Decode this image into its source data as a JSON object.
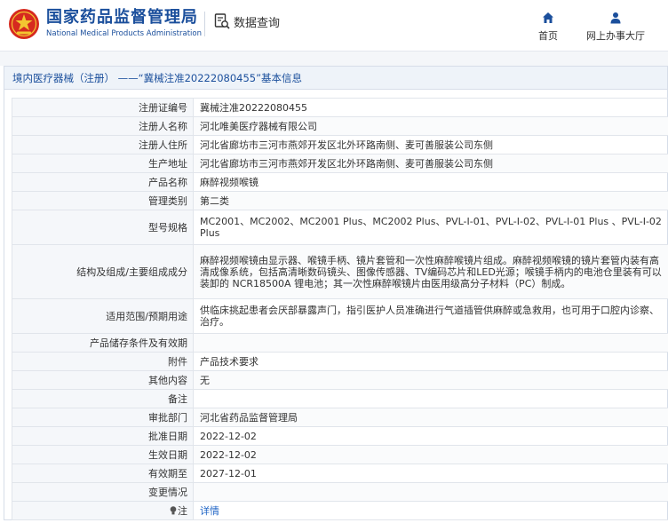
{
  "header": {
    "brand_cn": "国家药品监督管理局",
    "brand_en": "National Medical Products Administration",
    "query_label": "数据查询",
    "nav": [
      {
        "label": "首页",
        "icon": "home-icon"
      },
      {
        "label": "网上办事大厅",
        "icon": "user-icon"
      }
    ],
    "brand_color": "#1b4f9c",
    "logo_color": "#d62a1f"
  },
  "breadcrumb": "境内医疗器械（注册） ——“冀械注准20222080455”基本信息",
  "rows": [
    {
      "key": "注册证编号",
      "value": "冀械注准20222080455"
    },
    {
      "key": "注册人名称",
      "value": "河北唯美医疗器械有限公司"
    },
    {
      "key": "注册人住所",
      "value": "河北省廊坊市三河市燕郊开发区北外环路南侧、麦可善服装公司东侧"
    },
    {
      "key": "生产地址",
      "value": "河北省廊坊市三河市燕郊开发区北外环路南侧、麦可善服装公司东侧"
    },
    {
      "key": "产品名称",
      "value": "麻醉视频喉镜"
    },
    {
      "key": "管理类别",
      "value": "第二类"
    },
    {
      "key": "型号规格",
      "value": "MC2001、MC2002、MC2001 Plus、MC2002 Plus、PVL-I-01、PVL-I-02、PVL-I-01 Plus 、PVL-I-02 Plus"
    },
    {
      "key": "结构及组成/主要组成成分",
      "value": "麻醉视频喉镜由显示器、喉镜手柄、镜片套管和一次性麻醉喉镜片组成。麻醉视频喉镜的镜片套管内装有高清成像系统，包括高清晰数码镜头、图像传感器、TV编码芯片和LED光源；喉镜手柄内的电池仓里装有可以装卸的 NCR18500A 锂电池；其一次性麻醉喉镜片由医用级高分子材料（PC）制成。"
    },
    {
      "key": "适用范围/预期用途",
      "value": "供临床挑起患者会厌部暴露声门，指引医护人员准确进行气道插管供麻醉或急救用，也可用于口腔内诊察、治疗。"
    },
    {
      "key": "产品储存条件及有效期",
      "value": ""
    },
    {
      "key": "附件",
      "value": "产品技术要求"
    },
    {
      "key": "其他内容",
      "value": "无"
    },
    {
      "key": "备注",
      "value": ""
    },
    {
      "key": "审批部门",
      "value": "河北省药品监督管理局"
    },
    {
      "key": "批准日期",
      "value": "2022-12-02"
    },
    {
      "key": "生效日期",
      "value": "2022-12-02"
    },
    {
      "key": "有效期至",
      "value": "2027-12-01"
    },
    {
      "key": "变更情况",
      "value": ""
    },
    {
      "key": "注",
      "value": "详情",
      "icon": "bulb-icon"
    }
  ]
}
